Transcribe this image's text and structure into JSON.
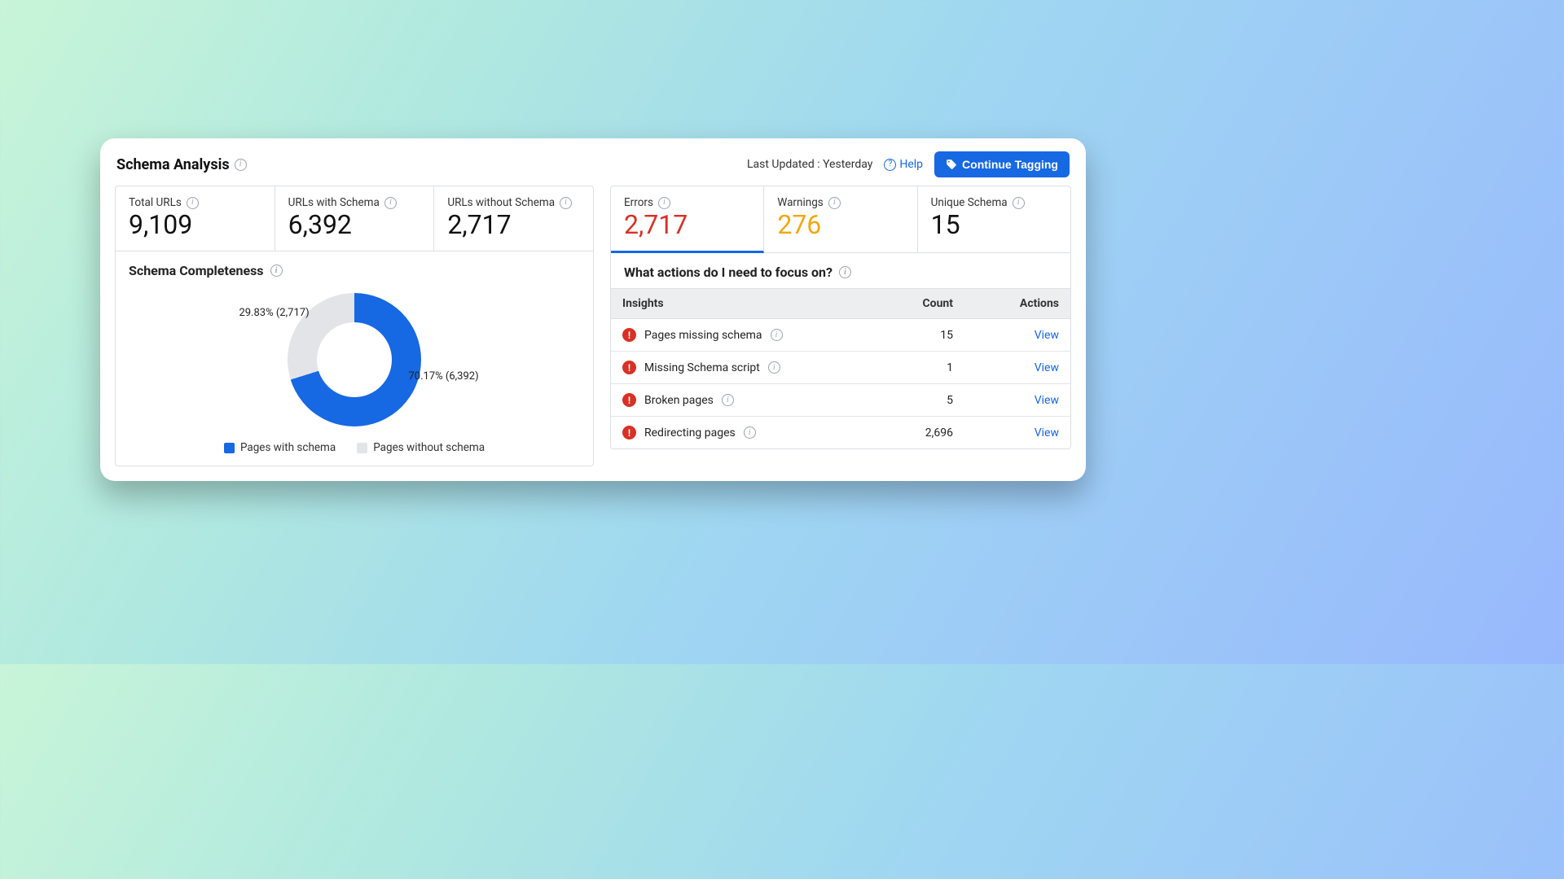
{
  "header": {
    "title": "Schema Analysis",
    "updated": "Last Updated : Yesterday",
    "help": "Help",
    "cta": "Continue Tagging"
  },
  "stats_left": [
    {
      "label": "Total URLs",
      "value": "9,109"
    },
    {
      "label": "URLs with Schema",
      "value": "6,392"
    },
    {
      "label": "URLs without Schema",
      "value": "2,717"
    }
  ],
  "stats_right": [
    {
      "label": "Errors",
      "value": "2,717",
      "cls": "red",
      "active": true
    },
    {
      "label": "Warnings",
      "value": "276",
      "cls": "yellow"
    },
    {
      "label": "Unique Schema",
      "value": "15",
      "cls": ""
    }
  ],
  "completeness": {
    "title": "Schema Completeness",
    "legend": {
      "a": "Pages with schema",
      "b": "Pages without schema"
    },
    "label_a": "70.17% (6,392)",
    "label_b": "29.83% (2,717)"
  },
  "chart_data": {
    "type": "pie",
    "title": "Schema Completeness",
    "series": [
      {
        "name": "Pages with schema",
        "value": 6392,
        "percent": 70.17,
        "color": "#1668e3"
      },
      {
        "name": "Pages without schema",
        "value": 2717,
        "percent": 29.83,
        "color": "#e2e4e8"
      }
    ]
  },
  "actions": {
    "title": "What actions do I need to focus on?",
    "columns": {
      "c1": "Insights",
      "c2": "Count",
      "c3": "Actions"
    },
    "view": "View",
    "rows": [
      {
        "label": "Pages missing schema",
        "count": "15"
      },
      {
        "label": "Missing Schema script",
        "count": "1"
      },
      {
        "label": "Broken pages",
        "count": "5"
      },
      {
        "label": "Redirecting pages",
        "count": "2,696"
      }
    ]
  }
}
